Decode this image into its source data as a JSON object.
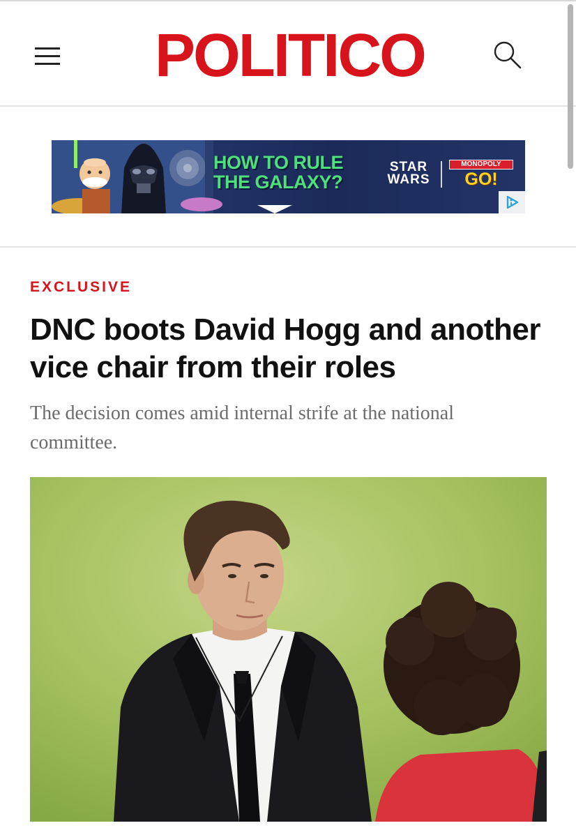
{
  "header": {
    "logo": "POLITICO"
  },
  "ad": {
    "headline": "HOW TO RULE THE GALAXY?",
    "brand_1": "STAR WARS",
    "brand_2_top": "MONOPOLY",
    "brand_2_bottom": "GO!",
    "ad_choices_icon": "adchoices-icon"
  },
  "article": {
    "kicker": "EXCLUSIVE",
    "headline": "DNC boots David Hogg and another vice chair from their roles",
    "dek": "The decision comes amid internal strife at the national committee."
  },
  "colors": {
    "brand_red": "#d7131b",
    "headline": "#111111",
    "dek": "#6b6b6b"
  },
  "icons": [
    "hamburger-menu-icon",
    "search-icon",
    "adchoices-icon"
  ]
}
